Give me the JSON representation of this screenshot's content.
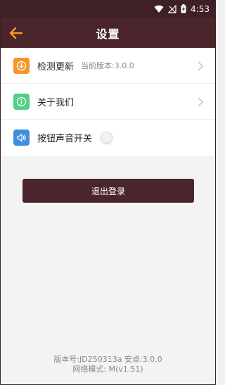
{
  "status_bar": {
    "time": "4:53",
    "icons": [
      "wifi-icon",
      "signal-off-icon",
      "battery-charging-icon"
    ]
  },
  "app_bar": {
    "title": "设置",
    "back_icon": "arrow-left-icon"
  },
  "settings": {
    "items": [
      {
        "icon": "download-circle-icon",
        "icon_color": "#f5962a",
        "label": "检测更新",
        "sub": "当前版本:3.0.0",
        "chevron": true
      },
      {
        "icon": "info-circle-icon",
        "icon_color": "#52d083",
        "label": "关于我们",
        "sub": "",
        "chevron": true
      },
      {
        "icon": "speaker-icon",
        "icon_color": "#3d8ee0",
        "label": "按钮声音开关",
        "sub": "",
        "toggle": false
      }
    ]
  },
  "logout": {
    "label": "退出登录"
  },
  "footer": {
    "line1": "版本号:JD250313a 安卓:3.0.0",
    "line2": "网络模式: M(v1.51)"
  },
  "colors": {
    "brand": "#4a252c",
    "accent_orange": "#f5962a"
  }
}
